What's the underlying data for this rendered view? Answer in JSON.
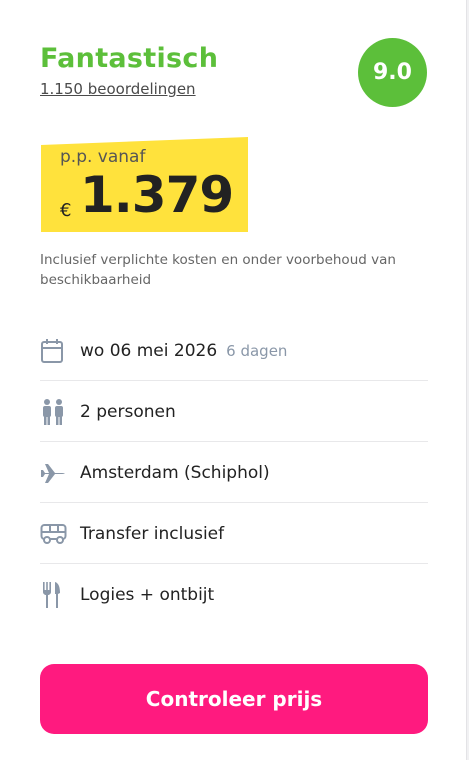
{
  "rating": {
    "label": "Fantastisch",
    "reviews": "1.150 beoordelingen",
    "score": "9.0",
    "color": "#5cbf3a"
  },
  "price": {
    "label": "p.p. vanaf",
    "currency": "€",
    "amount": "1.379",
    "highlight_color": "#ffe23c"
  },
  "disclaimer": "Inclusief verplichte kosten en onder voorbehoud van beschikbaarheid",
  "details": [
    {
      "icon": "calendar-icon",
      "text": "wo 06 mei 2026",
      "sub": "6 dagen"
    },
    {
      "icon": "persons-icon",
      "text": "2 personen"
    },
    {
      "icon": "airplane-icon",
      "text": "Amsterdam (Schiphol)"
    },
    {
      "icon": "bus-icon",
      "text": "Transfer inclusief"
    },
    {
      "icon": "cutlery-icon",
      "text": "Logies + ontbijt"
    }
  ],
  "cta": {
    "label": "Controleer prijs",
    "color": "#ff1a7f"
  }
}
